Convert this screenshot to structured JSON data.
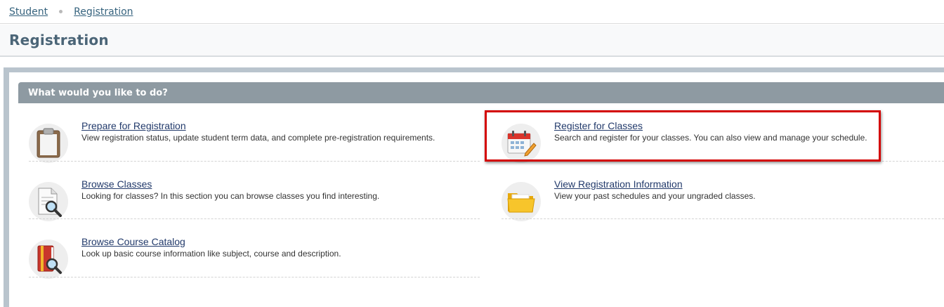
{
  "breadcrumb": {
    "items": [
      {
        "label": "Student"
      },
      {
        "label": "Registration"
      }
    ]
  },
  "page": {
    "title": "Registration"
  },
  "section": {
    "header": "What would you like to do?"
  },
  "actions": [
    {
      "id": "prepare",
      "icon": "clipboard-icon",
      "title": "Prepare for Registration",
      "description": "View registration status, update student term data, and complete pre-registration requirements."
    },
    {
      "id": "register",
      "icon": "calendar-pencil-icon",
      "title": "Register for Classes",
      "description": "Search and register for your classes. You can also view and manage your schedule.",
      "highlighted": true
    },
    {
      "id": "browse",
      "icon": "document-magnifier-icon",
      "title": "Browse Classes",
      "description": "Looking for classes? In this section you can browse classes you find interesting."
    },
    {
      "id": "view",
      "icon": "folder-icon",
      "title": "View Registration Information",
      "description": "View your past schedules and your ungraded classes."
    },
    {
      "id": "catalog",
      "icon": "book-magnifier-icon",
      "title": "Browse Course Catalog",
      "description": "Look up basic course information like subject, course and description."
    }
  ],
  "colors": {
    "link": "#223a6b",
    "breadcrumb_link": "#36637e",
    "section_header_bg": "#8e9aa2",
    "frame_bg": "#b9c4cd",
    "highlight_border": "#d30000"
  }
}
